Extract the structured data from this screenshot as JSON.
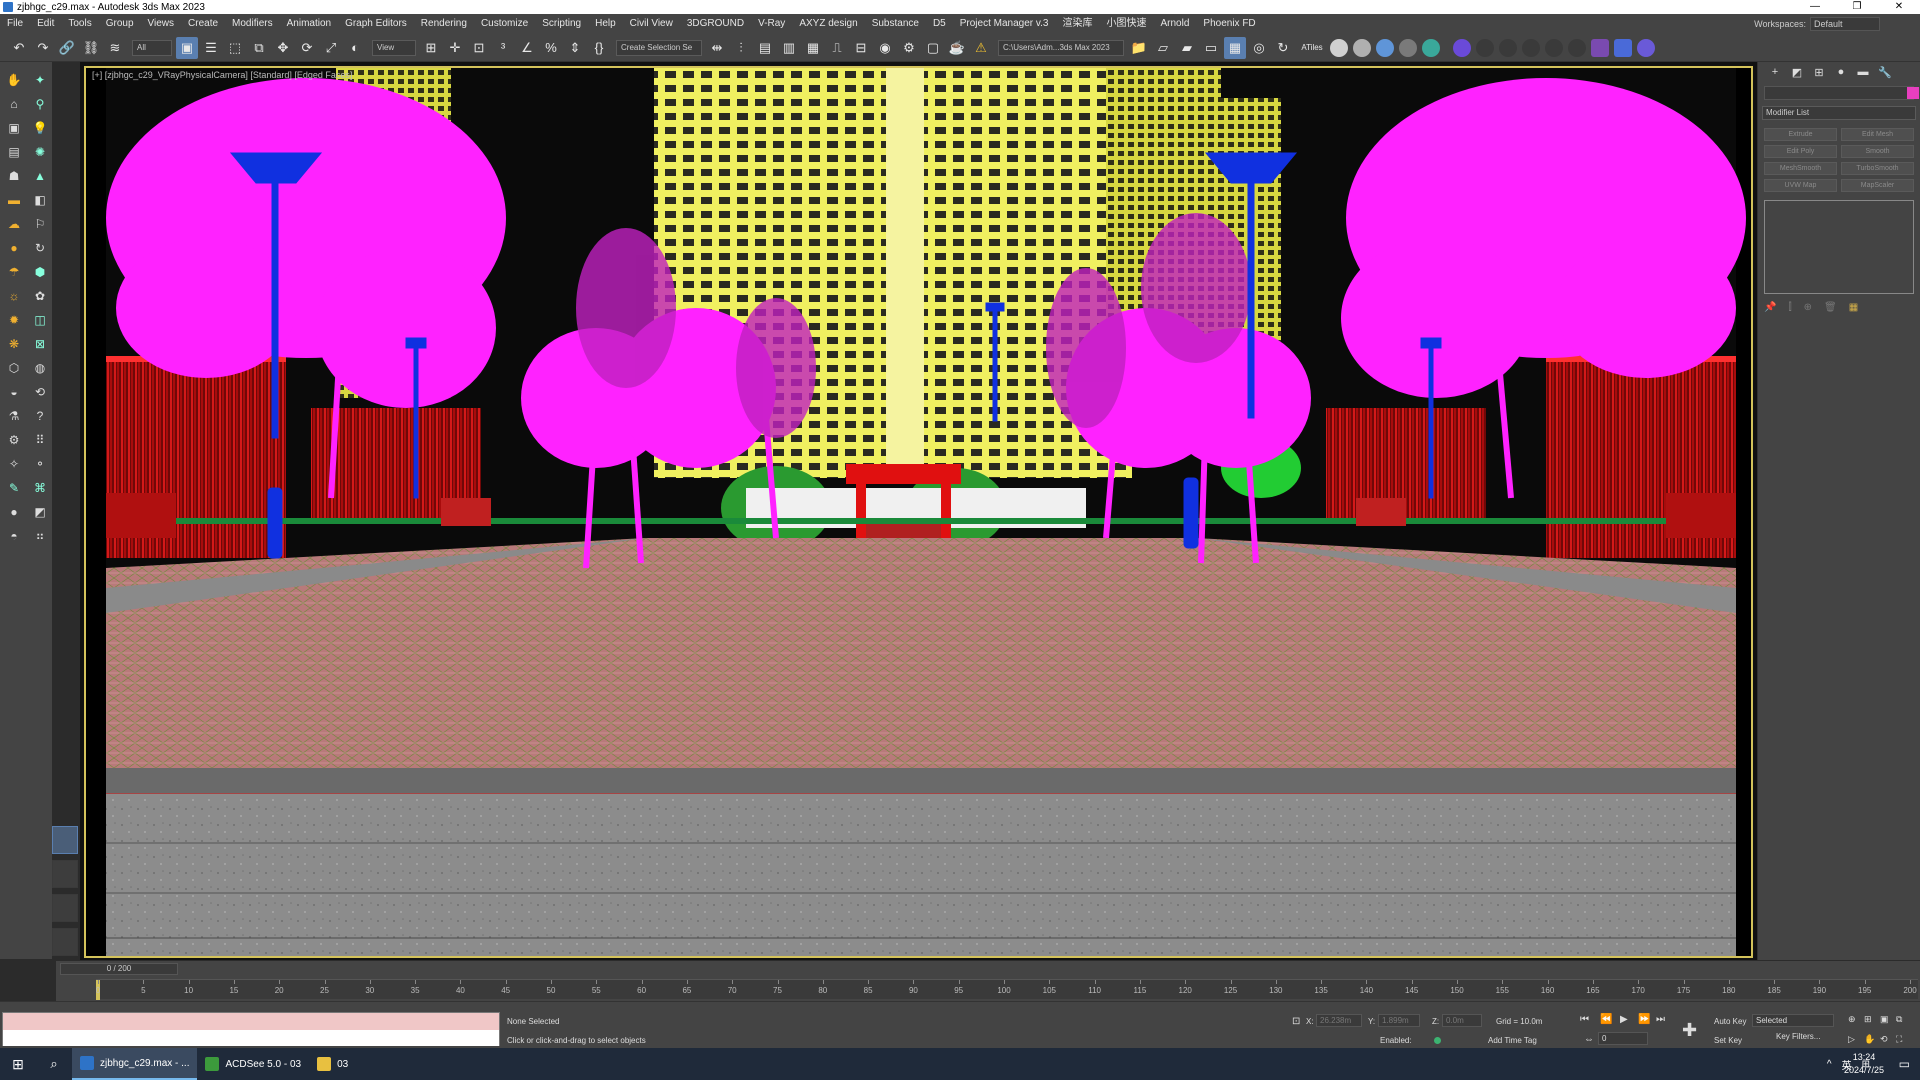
{
  "window": {
    "title": "zjbhgc_c29.max - Autodesk 3ds Max 2023",
    "controls": [
      "—",
      "❐",
      "✕"
    ]
  },
  "menu": {
    "items": [
      "File",
      "Edit",
      "Tools",
      "Group",
      "Views",
      "Create",
      "Modifiers",
      "Animation",
      "Graph Editors",
      "Rendering",
      "Customize",
      "Scripting",
      "Help",
      "Civil View",
      "3DGROUND",
      "V-Ray",
      "AXYZ design",
      "Substance",
      "D5",
      "Project Manager v.3",
      "渲染库",
      "小图快速",
      "Arnold",
      "Phoenix FD"
    ],
    "workspaces_label": "Workspaces:",
    "workspaces_value": "Default"
  },
  "toolbar": {
    "filter_value": "All",
    "refcoord_value": "View",
    "selection_set_placeholder": "Create Selection Se",
    "project_path": "C:\\Users\\Adm...3ds Max 2023",
    "atiles_label": "ATiles"
  },
  "viewport": {
    "label": "[+] [zjbhgc_c29_VRayPhysicalCamera] [Standard] [Edged Faces]",
    "colors": {
      "magenta": "#ff22ff",
      "red": "#e01010",
      "yellow": "#f0f060",
      "blue": "#1030e0",
      "green": "#22cc33",
      "floor_pink": "#c07a80",
      "pavement": "#8a8a8a"
    }
  },
  "command_panel": {
    "modifier_list_label": "Modifier List",
    "modifier_buttons": [
      "Extrude",
      "Edit Mesh",
      "Edit Poly",
      "Smooth",
      "MeshSmooth",
      "TurboSmooth",
      "UVW Map",
      "MapScaler"
    ],
    "selection_color": "#e83fbf"
  },
  "timeline": {
    "slider_label": "0 / 200",
    "ticks": [
      "0",
      "5",
      "10",
      "15",
      "20",
      "25",
      "30",
      "35",
      "40",
      "45",
      "50",
      "55",
      "60",
      "65",
      "70",
      "75",
      "80",
      "85",
      "90",
      "95",
      "100",
      "105",
      "110",
      "115",
      "120",
      "125",
      "130",
      "135",
      "140",
      "145",
      "150",
      "155",
      "160",
      "165",
      "170",
      "175",
      "180",
      "185",
      "190",
      "195",
      "200"
    ]
  },
  "status": {
    "selection": "None Selected",
    "prompt": "Click or click-and-drag to select objects",
    "x_label": "X:",
    "x_value": "26.238m",
    "y_label": "Y:",
    "y_value": "1.899m",
    "z_label": "Z:",
    "z_value": "0.0m",
    "grid": "Grid = 10.0m",
    "enabled_label": "Enabled:",
    "add_time_tag": "Add Time Tag",
    "auto_key": "Auto Key",
    "set_key": "Set Key",
    "key_mode": "Selected",
    "key_filters": "Key Filters...",
    "frame_value": "0"
  },
  "taskbar": {
    "items": [
      "zjbhgc_c29.max - ...",
      "ACDSee 5.0 - 03",
      "03"
    ],
    "ime": "英",
    "time": "13:24",
    "date": "2024/7/25"
  }
}
